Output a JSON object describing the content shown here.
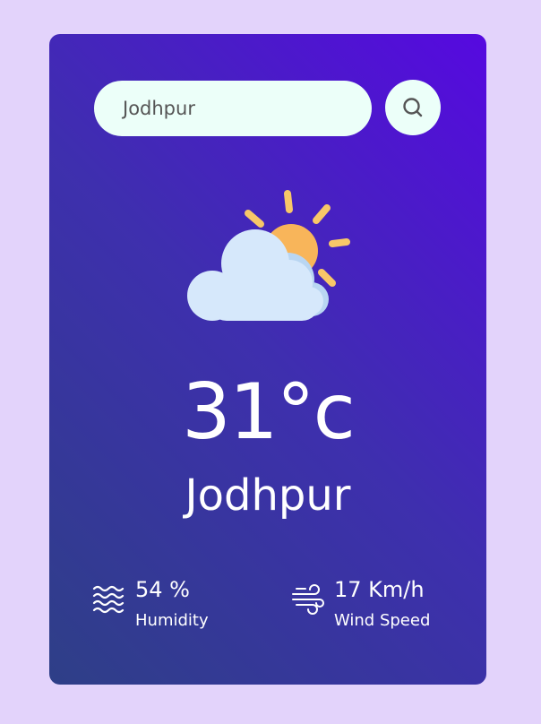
{
  "search": {
    "value": "Jodhpur"
  },
  "weather": {
    "temperature": "31°c",
    "city": "Jodhpur",
    "condition_icon": "partly-cloudy-icon"
  },
  "humidity": {
    "value": "54 %",
    "label": "Humidity",
    "icon": "humidity-waves-icon"
  },
  "wind": {
    "value": "17 Km/h",
    "label": "Wind Speed",
    "icon": "wind-icon"
  },
  "colors": {
    "background": "#e3d3fb",
    "card_gradient_start": "#2e3f87",
    "card_gradient_end": "#5609e0",
    "input_bg": "#ecfff9",
    "sun": "#f8b55a",
    "cloud": "#d6e8fb"
  }
}
